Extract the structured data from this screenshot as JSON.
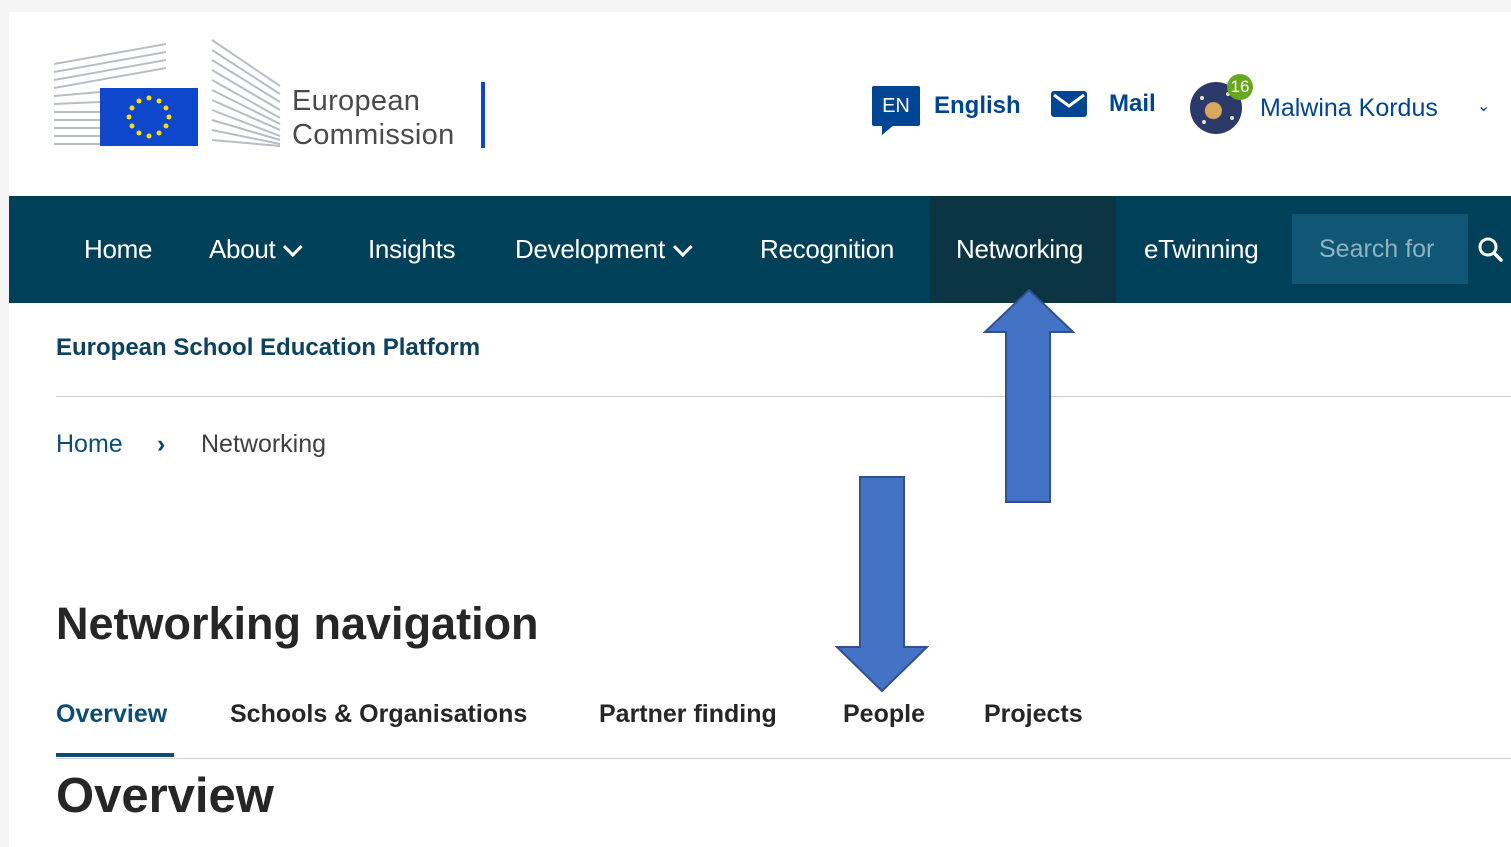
{
  "header": {
    "logo_text_line1": "European",
    "logo_text_line2": "Commission",
    "language_code": "EN",
    "language_label": "English",
    "mail_label": "Mail",
    "notification_count": "16",
    "user_name": "Malwina Kordus"
  },
  "nav": {
    "items": [
      {
        "label": "Home"
      },
      {
        "label": "About"
      },
      {
        "label": "Insights"
      },
      {
        "label": "Development"
      },
      {
        "label": "Recognition"
      },
      {
        "label": "Networking"
      },
      {
        "label": "eTwinning"
      }
    ],
    "search_placeholder": "Search for"
  },
  "site_name": "European School Education Platform",
  "breadcrumb": {
    "home": "Home",
    "separator": "›",
    "current": "Networking"
  },
  "section": {
    "title": "Networking navigation",
    "tabs": [
      {
        "label": "Overview",
        "active": true
      },
      {
        "label": "Schools & Organisations"
      },
      {
        "label": "Partner finding"
      },
      {
        "label": "People"
      },
      {
        "label": "Projects"
      }
    ],
    "content_title": "Overview"
  },
  "colors": {
    "nav_bg": "#004059",
    "nav_active_bg": "#0b3543",
    "brand_blue": "#004494",
    "arrow_fill": "#4472c4",
    "arrow_stroke": "#2f528f",
    "notification_badge": "#67a71e"
  }
}
